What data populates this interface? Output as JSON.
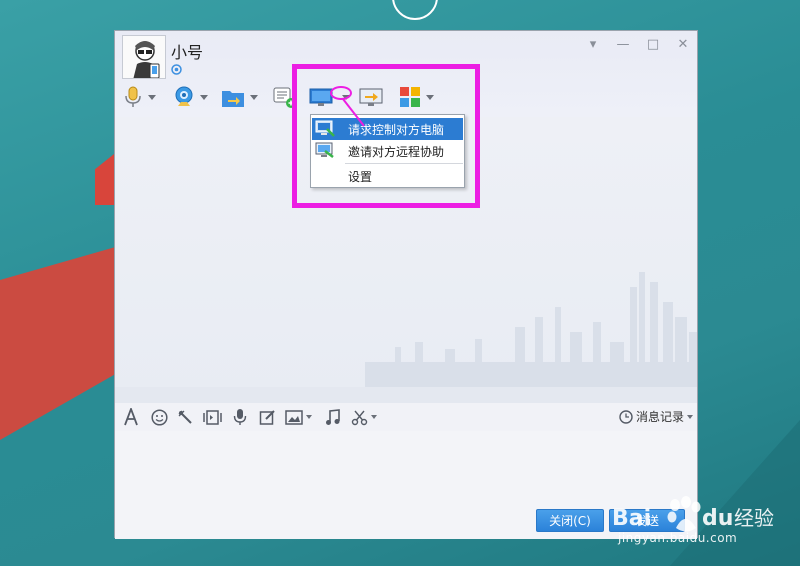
{
  "window": {
    "contact_name": "小号",
    "controls": {
      "menu": "▾",
      "minimize": "—",
      "maximize": "□",
      "close": "✕"
    }
  },
  "toolbar": {
    "items": [
      {
        "name": "voice-call-icon",
        "has_dropdown": true
      },
      {
        "name": "video-call-icon",
        "has_dropdown": true
      },
      {
        "name": "file-transfer-icon",
        "has_dropdown": true
      },
      {
        "name": "new-discussion-icon",
        "has_dropdown": false
      },
      {
        "name": "remote-desktop-icon",
        "has_dropdown": true
      },
      {
        "name": "share-screen-icon",
        "has_dropdown": false
      },
      {
        "name": "apps-grid-icon",
        "has_dropdown": true
      }
    ]
  },
  "remote_menu": {
    "items": [
      {
        "label": "请求控制对方电脑",
        "icon": "remote-control-icon",
        "active": true
      },
      {
        "label": "邀请对方远程协助",
        "icon": "remote-assist-icon",
        "active": false
      },
      {
        "label": "设置",
        "icon": "",
        "active": false
      }
    ]
  },
  "input_toolbar": {
    "items": [
      "font-icon",
      "emoji-icon",
      "nudge-icon",
      "gif-icon",
      "voice-message-icon",
      "edit-icon",
      "image-icon",
      "music-icon",
      "screenshot-icon"
    ],
    "history_label": "消息记录"
  },
  "buttons": {
    "close_label": "关闭(C)",
    "send_label": "发送"
  },
  "watermark": {
    "url": "jingyan.baidu.com",
    "brand": "Bai经验"
  },
  "colors": {
    "highlight": "#ec1ee3",
    "accent_blue": "#2c7cd2",
    "desktop": "#2b8a92"
  }
}
